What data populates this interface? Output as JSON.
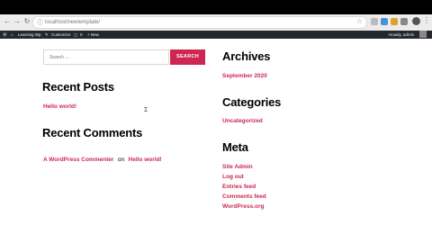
{
  "browser": {
    "url": "localhost/newtemplate/"
  },
  "adminbar": {
    "site_name": "Learning Wp",
    "customize": "Customize",
    "comments_count": "0",
    "new_label": "+ New",
    "howdy": "Howdy, admin"
  },
  "search": {
    "placeholder": "Search ...",
    "button_label": "SEARCH"
  },
  "recent_posts": {
    "title": "Recent Posts",
    "items": [
      "Hello world!"
    ]
  },
  "recent_comments": {
    "title": "Recent Comments",
    "author": "A WordPress Commenter",
    "on": "on",
    "post": "Hello world!"
  },
  "archives": {
    "title": "Archives",
    "items": [
      "September 2020"
    ]
  },
  "categories": {
    "title": "Categories",
    "items": [
      "Uncategorized"
    ]
  },
  "meta": {
    "title": "Meta",
    "items": [
      "Site Admin",
      "Log out",
      "Entries feed",
      "Comments feed",
      "WordPress.org"
    ]
  },
  "colors": {
    "accent": "#cd2653",
    "adminbar": "#23282d"
  }
}
